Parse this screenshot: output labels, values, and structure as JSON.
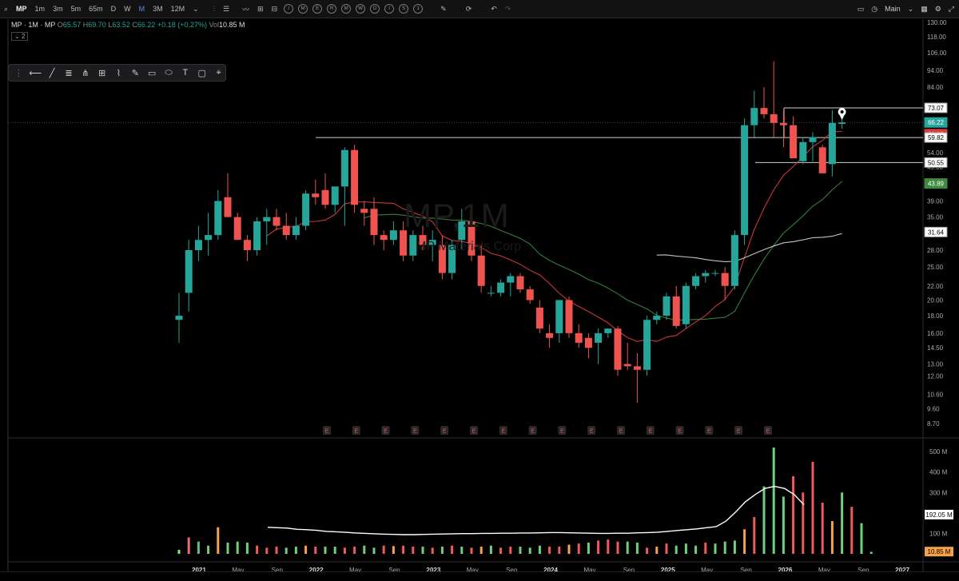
{
  "topbar": {
    "symbol": "MP",
    "timeframes": [
      "1m",
      "3m",
      "5m",
      "65m",
      "D",
      "W",
      "M",
      "3M",
      "12M"
    ],
    "active_timeframe": "M",
    "indicator_letters": [
      "I",
      "M",
      "E",
      "R",
      "M",
      "W",
      "D",
      "I",
      "S",
      "1"
    ],
    "layout_name": "Main"
  },
  "legend": {
    "title": "MP · 1M · MP",
    "o_label": "O",
    "o": "65.57",
    "h_label": "H",
    "h": "69.70",
    "l_label": "L",
    "l": "63.52",
    "c_label": "C",
    "c": "66.22",
    "change": "+0.18 (+0.27%)",
    "vol_label": "Vol",
    "vol": "10.85 M",
    "collapse_count": "2"
  },
  "watermark": {
    "main": "MP,1M",
    "sub": "MP Materials Corp"
  },
  "colors": {
    "up": "#26a69a",
    "down": "#ef5350",
    "bg": "#000000",
    "ma10": "#e03c3c",
    "ma20": "#3f8a3f",
    "ma50": "#d8d8d8",
    "vol_line": "#ffffff"
  },
  "icons": [
    "arrow-left-icon",
    "trend-line-icon",
    "fib-icon",
    "pitchfork-icon",
    "grid-icon",
    "brush-icon",
    "pen-icon",
    "rectangle-icon",
    "ellipse-icon",
    "text-icon",
    "callout-icon",
    "pin-icon"
  ],
  "chart_data": {
    "type": "candlestick",
    "interval": "monthly",
    "ylog": true,
    "y_ticks": [
      8.7,
      9.6,
      10.6,
      12.0,
      13.0,
      14.5,
      16.0,
      18.0,
      20.0,
      22.0,
      25.0,
      28.0,
      31.0,
      35.0,
      39.0,
      44.0,
      49.0,
      54.0,
      60.0,
      66.0,
      73.0,
      84.0,
      94.0,
      106.0,
      118.0,
      130.0
    ],
    "x_tick_labels": [
      "2021",
      "May",
      "Sep",
      "2022",
      "May",
      "Sep",
      "2023",
      "May",
      "Sep",
      "2024",
      "May",
      "Sep",
      "2025",
      "May",
      "Sep",
      "2026",
      "May",
      "Sep",
      "2027"
    ],
    "candles": [
      {
        "o": 17.5,
        "h": 21,
        "l": 15,
        "c": 18
      },
      {
        "o": 21,
        "h": 30,
        "l": 18.5,
        "c": 28
      },
      {
        "o": 28,
        "h": 33,
        "l": 26,
        "c": 30
      },
      {
        "o": 30,
        "h": 36,
        "l": 27,
        "c": 31
      },
      {
        "o": 31,
        "h": 42,
        "l": 30,
        "c": 39
      },
      {
        "o": 40,
        "h": 47,
        "l": 35,
        "c": 35
      },
      {
        "o": 35,
        "h": 36,
        "l": 30,
        "c": 30
      },
      {
        "o": 30,
        "h": 31,
        "l": 26,
        "c": 28
      },
      {
        "o": 28,
        "h": 35,
        "l": 27,
        "c": 34
      },
      {
        "o": 34,
        "h": 37,
        "l": 29,
        "c": 35
      },
      {
        "o": 35,
        "h": 37,
        "l": 32,
        "c": 33
      },
      {
        "o": 33,
        "h": 36,
        "l": 30,
        "c": 31
      },
      {
        "o": 31,
        "h": 35,
        "l": 30,
        "c": 33
      },
      {
        "o": 33,
        "h": 42,
        "l": 32,
        "c": 41
      },
      {
        "o": 41,
        "h": 45,
        "l": 38,
        "c": 40
      },
      {
        "o": 42,
        "h": 47,
        "l": 37,
        "c": 38
      },
      {
        "o": 38,
        "h": 43,
        "l": 36,
        "c": 43
      },
      {
        "o": 43,
        "h": 56,
        "l": 33,
        "c": 55
      },
      {
        "o": 55,
        "h": 57,
        "l": 36,
        "c": 38
      },
      {
        "o": 37,
        "h": 39,
        "l": 33,
        "c": 36
      },
      {
        "o": 37,
        "h": 40,
        "l": 29,
        "c": 31
      },
      {
        "o": 31,
        "h": 32,
        "l": 28,
        "c": 30
      },
      {
        "o": 30,
        "h": 34,
        "l": 29,
        "c": 32
      },
      {
        "o": 32,
        "h": 34,
        "l": 26,
        "c": 27
      },
      {
        "o": 27,
        "h": 32,
        "l": 26,
        "c": 31
      },
      {
        "o": 31,
        "h": 33,
        "l": 28,
        "c": 29
      },
      {
        "o": 29,
        "h": 32,
        "l": 26,
        "c": 30
      },
      {
        "o": 29,
        "h": 31,
        "l": 23,
        "c": 24
      },
      {
        "o": 24,
        "h": 30,
        "l": 23,
        "c": 29
      },
      {
        "o": 30,
        "h": 37,
        "l": 28,
        "c": 34
      },
      {
        "o": 34,
        "h": 35,
        "l": 26,
        "c": 27
      },
      {
        "o": 27,
        "h": 29,
        "l": 21,
        "c": 22
      },
      {
        "o": 21,
        "h": 22,
        "l": 20.5,
        "c": 21
      },
      {
        "o": 21,
        "h": 23,
        "l": 20.5,
        "c": 22.5
      },
      {
        "o": 22.5,
        "h": 24,
        "l": 20.5,
        "c": 23.5
      },
      {
        "o": 23.5,
        "h": 24,
        "l": 21,
        "c": 21.5
      },
      {
        "o": 21.5,
        "h": 22,
        "l": 19.5,
        "c": 20
      },
      {
        "o": 19,
        "h": 20,
        "l": 16,
        "c": 16.5
      },
      {
        "o": 16,
        "h": 17,
        "l": 14.5,
        "c": 15.5
      },
      {
        "o": 16,
        "h": 20,
        "l": 15,
        "c": 20
      },
      {
        "o": 20,
        "h": 20.5,
        "l": 15.5,
        "c": 16
      },
      {
        "o": 16,
        "h": 17,
        "l": 14.5,
        "c": 15
      },
      {
        "o": 15.5,
        "h": 16,
        "l": 13.5,
        "c": 14.5
      },
      {
        "o": 15,
        "h": 16.5,
        "l": 13,
        "c": 16
      },
      {
        "o": 16,
        "h": 16.5,
        "l": 15.5,
        "c": 16.5
      },
      {
        "o": 16.5,
        "h": 16.8,
        "l": 12,
        "c": 12.5
      },
      {
        "o": 13,
        "h": 15,
        "l": 12.5,
        "c": 12.8
      },
      {
        "o": 12.8,
        "h": 14,
        "l": 10,
        "c": 12.5
      },
      {
        "o": 12.5,
        "h": 18,
        "l": 12,
        "c": 17.5
      },
      {
        "o": 17.5,
        "h": 18.5,
        "l": 17,
        "c": 18
      },
      {
        "o": 18,
        "h": 21,
        "l": 17.5,
        "c": 20.5
      },
      {
        "o": 20.5,
        "h": 22,
        "l": 16.5,
        "c": 16.8
      },
      {
        "o": 17,
        "h": 22.5,
        "l": 16.5,
        "c": 22
      },
      {
        "o": 22,
        "h": 24,
        "l": 21.5,
        "c": 23.5
      },
      {
        "o": 23.5,
        "h": 24.5,
        "l": 22.5,
        "c": 24
      },
      {
        "o": 24,
        "h": 24.5,
        "l": 23.5,
        "c": 24
      },
      {
        "o": 24,
        "h": 25,
        "l": 20,
        "c": 22
      },
      {
        "o": 22,
        "h": 32,
        "l": 21.5,
        "c": 31
      },
      {
        "o": 31,
        "h": 68,
        "l": 29,
        "c": 65
      },
      {
        "o": 65,
        "h": 82,
        "l": 60,
        "c": 73
      },
      {
        "o": 73,
        "h": 84,
        "l": 68,
        "c": 70
      },
      {
        "o": 70,
        "h": 100,
        "l": 60,
        "c": 66
      },
      {
        "o": 66,
        "h": 72,
        "l": 56,
        "c": 65
      },
      {
        "o": 65,
        "h": 69,
        "l": 57,
        "c": 52
      },
      {
        "o": 51,
        "h": 60,
        "l": 50,
        "c": 58
      },
      {
        "o": 58,
        "h": 62,
        "l": 51,
        "c": 60
      },
      {
        "o": 56,
        "h": 57,
        "l": 47,
        "c": 47
      },
      {
        "o": 50,
        "h": 72,
        "l": 46,
        "c": 66
      },
      {
        "o": 65.57,
        "h": 69.7,
        "l": 63.52,
        "c": 66.22
      }
    ],
    "volume_ticks": [
      "500 M",
      "400 M",
      "300 M",
      "200 M",
      "100 M"
    ],
    "volumes": [
      20,
      80,
      60,
      40,
      130,
      55,
      60,
      55,
      40,
      30,
      35,
      30,
      35,
      40,
      35,
      35,
      35,
      30,
      35,
      40,
      30,
      40,
      38,
      40,
      35,
      35,
      30,
      35,
      40,
      35,
      30,
      35,
      40,
      30,
      35,
      35,
      30,
      40,
      35,
      35,
      45,
      50,
      55,
      65,
      70,
      60,
      60,
      55,
      30,
      35,
      50,
      40,
      50,
      40,
      55,
      50,
      60,
      65,
      120,
      180,
      330,
      520,
      280,
      380,
      300,
      450,
      250,
      160,
      300,
      230,
      150,
      10
    ],
    "volume_ma": [
      130,
      128,
      126,
      120,
      118,
      115,
      110,
      108,
      105,
      102,
      100,
      98,
      96,
      95,
      94,
      94,
      95,
      96,
      97,
      98,
      99,
      99,
      100,
      100,
      101,
      101,
      102,
      102,
      103,
      104,
      104,
      103,
      102,
      101,
      100,
      100,
      101,
      101,
      103,
      104,
      106,
      110,
      114,
      118,
      122,
      128,
      133,
      160,
      205,
      255,
      290,
      320,
      330,
      320,
      290,
      240
    ],
    "price_labels": [
      {
        "value": "73.07",
        "kind": "level"
      },
      {
        "value": "66.22",
        "kind": "last"
      },
      {
        "value": "61.19",
        "kind": "ma10"
      },
      {
        "value": "59.82",
        "kind": "level"
      },
      {
        "value": "50.55",
        "kind": "level"
      },
      {
        "value": "43.89",
        "kind": "ma20"
      },
      {
        "value": "31.64",
        "kind": "ma50"
      }
    ],
    "volume_labels": [
      {
        "value": "192.05 M",
        "kind": "vol_ma"
      },
      {
        "value": "10.85 M",
        "kind": "vol"
      }
    ],
    "earnings_marker": "E",
    "earnings_count": 16
  }
}
